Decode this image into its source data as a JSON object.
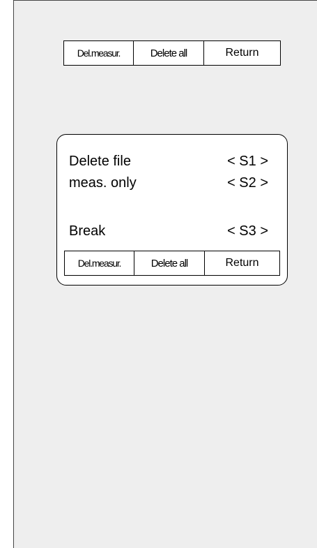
{
  "top_softkeys": {
    "del_measur": "Del.measur.",
    "delete_all": "Delete all",
    "return": "Return"
  },
  "dialog": {
    "rows": [
      {
        "label": "Delete file",
        "key": "< S1 >"
      },
      {
        "label": "meas. only",
        "key": "< S2 >"
      },
      {
        "label": "Break",
        "key": "< S3 >"
      }
    ],
    "softkeys": {
      "del_measur": "Del.measur.",
      "delete_all": "Delete all",
      "return": "Return"
    }
  }
}
